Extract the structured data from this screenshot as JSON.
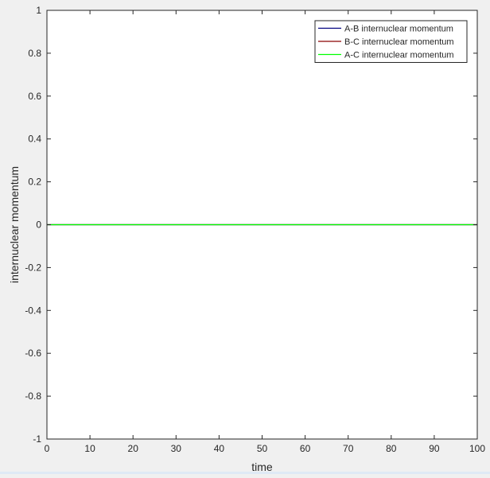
{
  "chart_data": {
    "type": "line",
    "title": "",
    "xlabel": "time",
    "ylabel": "internuclear momentum",
    "xlim": [
      0,
      100
    ],
    "ylim": [
      -1,
      1
    ],
    "xticks": [
      0,
      10,
      20,
      30,
      40,
      50,
      60,
      70,
      80,
      90,
      100
    ],
    "yticks": [
      -1,
      -0.8,
      -0.6,
      -0.4,
      -0.2,
      0,
      0.2,
      0.4,
      0.6,
      0.8,
      1
    ],
    "xtick_labels": [
      "0",
      "10",
      "20",
      "30",
      "40",
      "50",
      "60",
      "70",
      "80",
      "90",
      "100"
    ],
    "ytick_labels": [
      "-1",
      "-0.8",
      "-0.6",
      "-0.4",
      "-0.2",
      "0",
      "0.2",
      "0.4",
      "0.6",
      "0.8",
      "1"
    ],
    "grid": false,
    "legend_position": "top-right",
    "series": [
      {
        "name": "A-B internuclear momentum",
        "color": "#000080",
        "x": [
          0,
          100
        ],
        "y": [
          0,
          0
        ]
      },
      {
        "name": "B-C internuclear momentum",
        "color": "#8b0000",
        "x": [
          0,
          100
        ],
        "y": [
          0,
          0
        ]
      },
      {
        "name": "A-C internuclear momentum",
        "color": "#00ff00",
        "x": [
          0,
          100
        ],
        "y": [
          0,
          0
        ]
      }
    ]
  }
}
